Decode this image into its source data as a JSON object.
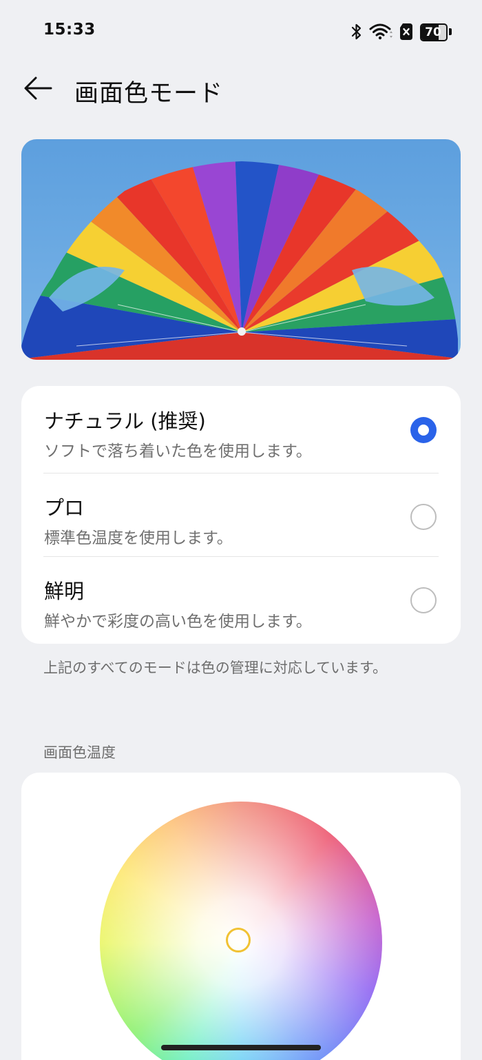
{
  "status_bar": {
    "time": "15:33",
    "icons": [
      "bluetooth-icon",
      "wifi-icon",
      "no-sim-icon",
      "battery-icon"
    ],
    "battery_level": 70,
    "battery_text": "70"
  },
  "header": {
    "back_icon": "arrow-left-icon",
    "title": "画面色モード"
  },
  "preview": {
    "image": "rainbow-parachute-canopy"
  },
  "modes": [
    {
      "title": "ナチュラル (推奨)",
      "description": "ソフトで落ち着いた色を使用します。",
      "selected": true
    },
    {
      "title": "プロ",
      "description": "標準色温度を使用します。",
      "selected": false
    },
    {
      "title": "鮮明",
      "description": "鮮やかで彩度の高い色を使用します。",
      "selected": false
    }
  ],
  "note": "上記のすべてのモードは色の管理に対応しています。",
  "color_temperature": {
    "label": "画面色温度"
  },
  "colors": {
    "accent": "#2a63e9",
    "background": "#eff0f3",
    "handle": "#f1c233"
  }
}
